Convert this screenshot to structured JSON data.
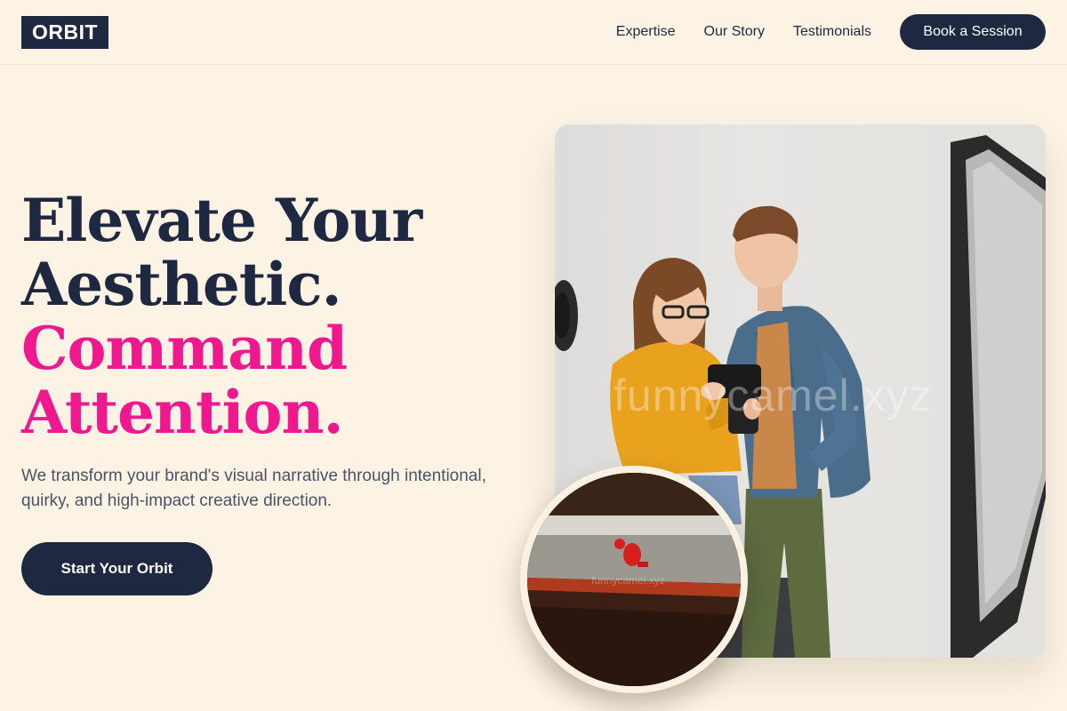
{
  "nav": {
    "logo": "ORBIT",
    "links": [
      "Expertise",
      "Our Story",
      "Testimonials"
    ],
    "cta": "Book a Session"
  },
  "hero": {
    "title_lines": [
      "Elevate Your",
      "Aesthetic.",
      "Command",
      "Attention."
    ],
    "subtitle": "We transform your brand's visual narrative through intentional, quirky, and high-impact creative direction.",
    "cta": "Start Your Orbit"
  },
  "images": {
    "main_watermark": "funnycamel.xyz",
    "inset_watermark": "funnycamel.xyz"
  },
  "colors": {
    "background": "#fdf3e4",
    "navy": "#1e2840",
    "accent_pink": "#f0188f"
  }
}
